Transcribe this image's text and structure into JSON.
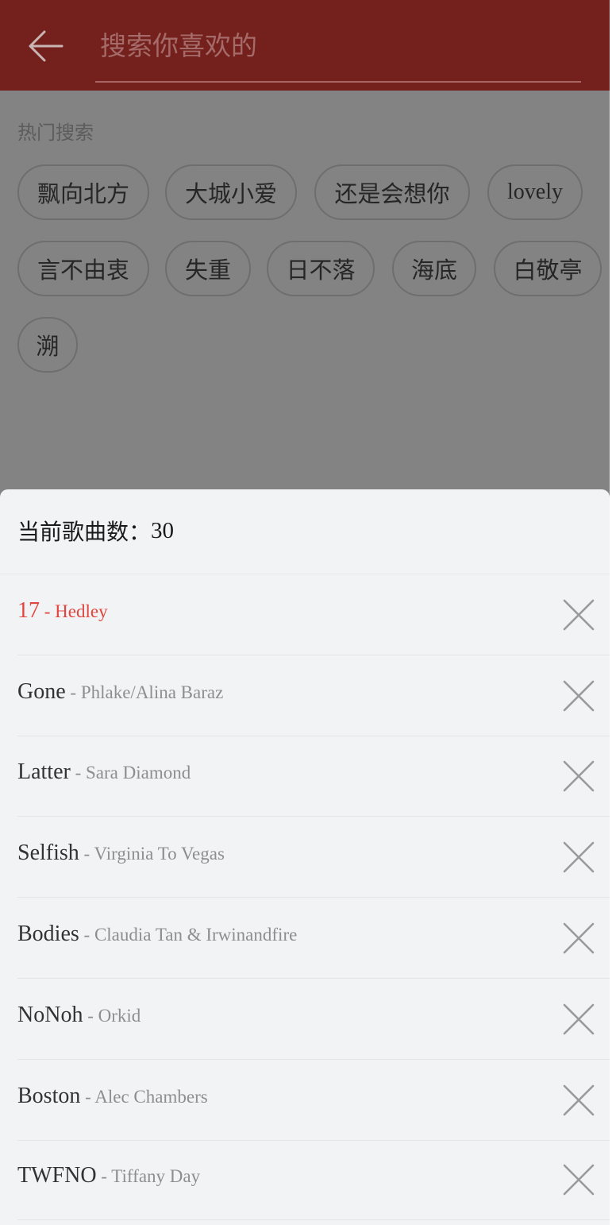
{
  "header": {
    "search_placeholder": "搜索你喜欢的",
    "back_icon": "arrow-left-icon"
  },
  "hot": {
    "title": "热门搜索",
    "tags": [
      "飘向北方",
      "大城小爱",
      "还是会想你",
      "lovely",
      "言不由衷",
      "失重",
      "日不落",
      "海底",
      "白敬亭",
      "溯"
    ]
  },
  "playlist": {
    "count_label": "当前歌曲数：",
    "count_value": "30",
    "separator": " - ",
    "active_color": "#e0453e",
    "items": [
      {
        "song": "17",
        "artist": "Hedley",
        "active": true
      },
      {
        "song": "Gone",
        "artist": "Phlake/Alina Baraz"
      },
      {
        "song": "Latter",
        "artist": "Sara Diamond"
      },
      {
        "song": "Selfish",
        "artist": "Virginia To Vegas"
      },
      {
        "song": "Bodies",
        "artist": "Claudia Tan & Irwinandfire"
      },
      {
        "song": "NoNoh",
        "artist": "Orkid"
      },
      {
        "song": "Boston",
        "artist": "Alec Chambers"
      },
      {
        "song": "TWFNO",
        "artist": "Tiffany Day"
      }
    ]
  },
  "colors": {
    "header_bg": "#74211e",
    "overlay_bg": "#838383",
    "panel_bg": "#f2f3f5"
  }
}
